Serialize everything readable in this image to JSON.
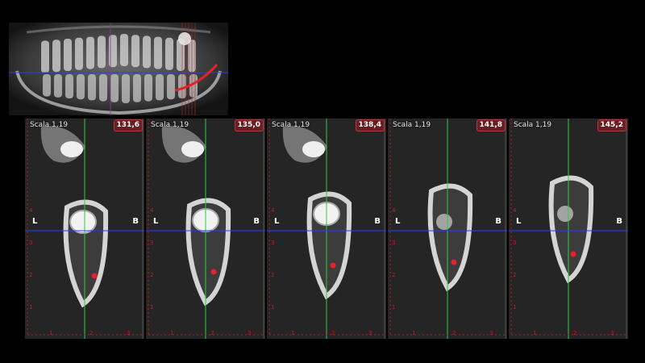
{
  "panoramic": {
    "teeth_upper": 14,
    "teeth_lower": 14
  },
  "slices": [
    {
      "scale": "Scala 1,19",
      "position": "131,6",
      "left_label": "L",
      "right_label": "B",
      "ruler_x": [
        "1",
        "2",
        "3"
      ],
      "ruler_y": [
        "4",
        "3",
        "2",
        "1"
      ]
    },
    {
      "scale": "Scala 1,19",
      "position": "135,0",
      "left_label": "L",
      "right_label": "B",
      "ruler_x": [
        "1",
        "2",
        "3"
      ],
      "ruler_y": [
        "4",
        "3",
        "2",
        "1"
      ]
    },
    {
      "scale": "Scala 1,19",
      "position": "138,4",
      "left_label": "L",
      "right_label": "B",
      "ruler_x": [
        "1",
        "2",
        "3"
      ],
      "ruler_y": [
        "4",
        "3",
        "2",
        "1"
      ]
    },
    {
      "scale": "Scala 1,19",
      "position": "141,8",
      "left_label": "L",
      "right_label": "B",
      "ruler_x": [
        "1",
        "2",
        "3"
      ],
      "ruler_y": [
        "4",
        "3",
        "2",
        "1"
      ]
    },
    {
      "scale": "Scala 1,19",
      "position": "145,2",
      "left_label": "L",
      "right_label": "B",
      "ruler_x": [
        "1",
        "2",
        "3"
      ],
      "ruler_y": [
        "4",
        "3",
        "2",
        "1"
      ]
    }
  ],
  "colors": {
    "crosshair_vertical": "#2ecc40",
    "crosshair_horizontal": "#2a3cff",
    "nerve_canal": "#e8202a",
    "ruler": "#b01e1e",
    "badge_bg": "#6b1e22"
  }
}
